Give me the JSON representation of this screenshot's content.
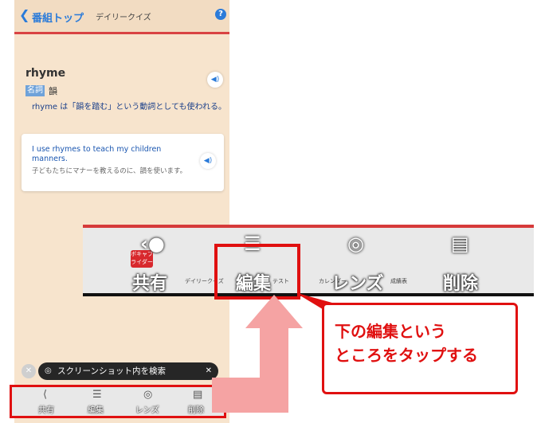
{
  "phone": {
    "back_label": "番組トップ",
    "section_title": "デイリークイズ",
    "help_icon": "?",
    "word": "rhyme",
    "part_of_speech": "名詞",
    "word_ja": "韻",
    "definition": "rhyme は「韻を踏む」という動詞としても使われる。",
    "example_en": "I use rhymes to teach my children manners.",
    "example_ja": "子どもたちにマナーを教えるのに、韻を使います。",
    "search_chip": "スクリーンショット内を検索"
  },
  "toolbar": {
    "share": "共有",
    "edit": "編集",
    "lens": "レンズ",
    "delete": "削除",
    "daily_quiz": "デイリークイズ",
    "test": "テスト",
    "calendar": "カレンダー",
    "results": "成績表",
    "app_badge": "ボキャブライダー"
  },
  "callout": {
    "line1": "下の編集という",
    "line2": "ところをタップする"
  },
  "colors": {
    "accent_red": "#e01010",
    "arrow_pink": "#f5a3a3",
    "link_blue": "#2b7bd9"
  }
}
